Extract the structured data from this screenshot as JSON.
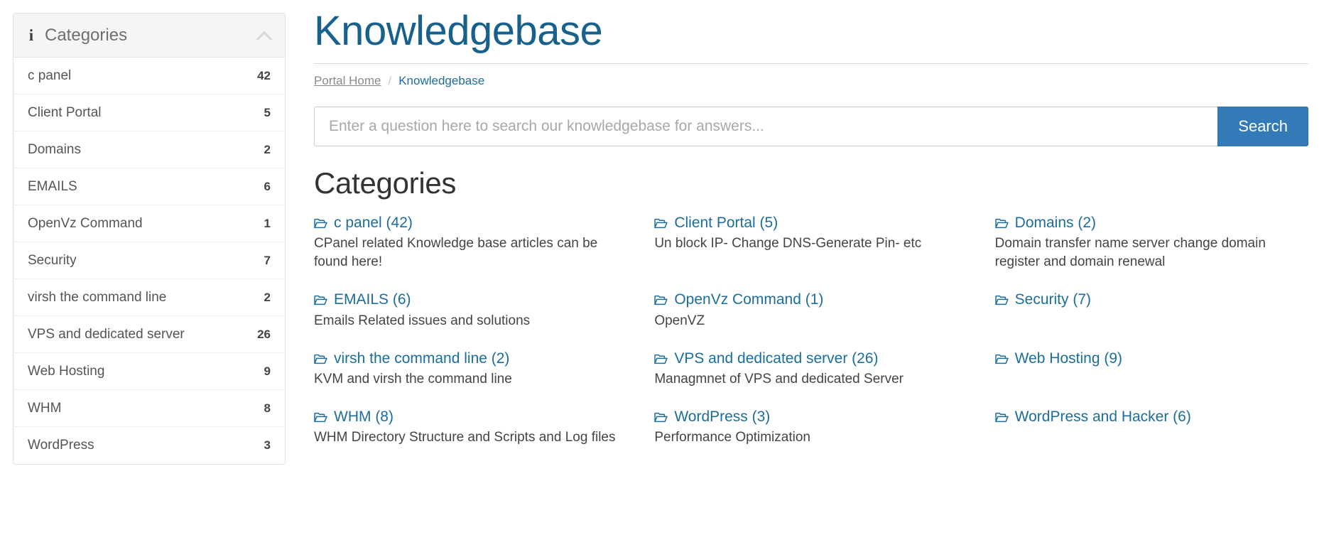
{
  "sidebar": {
    "panel_title": "Categories",
    "info_icon": "info-icon",
    "collapse_icon": "chevron-up-icon",
    "items": [
      {
        "label": "c panel",
        "count": "42"
      },
      {
        "label": "Client Portal",
        "count": "5"
      },
      {
        "label": "Domains",
        "count": "2"
      },
      {
        "label": "EMAILS",
        "count": "6"
      },
      {
        "label": "OpenVz Command",
        "count": "1"
      },
      {
        "label": "Security",
        "count": "7"
      },
      {
        "label": "virsh the command line",
        "count": "2"
      },
      {
        "label": "VPS and dedicated server",
        "count": "26"
      },
      {
        "label": "Web Hosting",
        "count": "9"
      },
      {
        "label": "WHM",
        "count": "8"
      },
      {
        "label": "WordPress",
        "count": "3"
      }
    ]
  },
  "main": {
    "title": "Knowledgebase",
    "breadcrumb": {
      "home": "Portal Home",
      "separator": "/",
      "current": "Knowledgebase"
    },
    "search": {
      "placeholder": "Enter a question here to search our knowledgebase for answers...",
      "value": "",
      "button_label": "Search"
    },
    "section_title": "Categories",
    "categories": [
      {
        "title": "c panel (42)",
        "desc": "CPanel related Knowledge base articles can be found here!"
      },
      {
        "title": "Client Portal (5)",
        "desc": "Un block IP- Change DNS-Generate Pin- etc"
      },
      {
        "title": "Domains (2)",
        "desc": "Domain transfer name server change domain register and domain renewal"
      },
      {
        "title": "EMAILS (6)",
        "desc": "Emails Related issues and solutions"
      },
      {
        "title": "OpenVz Command (1)",
        "desc": "OpenVZ"
      },
      {
        "title": "Security (7)",
        "desc": ""
      },
      {
        "title": "virsh the command line (2)",
        "desc": "KVM and virsh the command line"
      },
      {
        "title": "VPS and dedicated server (26)",
        "desc": "Managmnet of VPS and dedicated Server"
      },
      {
        "title": "Web Hosting (9)",
        "desc": ""
      },
      {
        "title": "WHM (8)",
        "desc": "WHM Directory Structure and Scripts and Log files"
      },
      {
        "title": "WordPress (3)",
        "desc": "Performance Optimization"
      },
      {
        "title": "WordPress and Hacker (6)",
        "desc": ""
      }
    ]
  },
  "colors": {
    "title_blue": "#18618c",
    "link_blue": "#1b6d9c",
    "button_blue": "#337ab7",
    "panel_header_bg": "#f5f5f5",
    "text_dark": "#333333",
    "text_muted": "#8a8a8a"
  }
}
